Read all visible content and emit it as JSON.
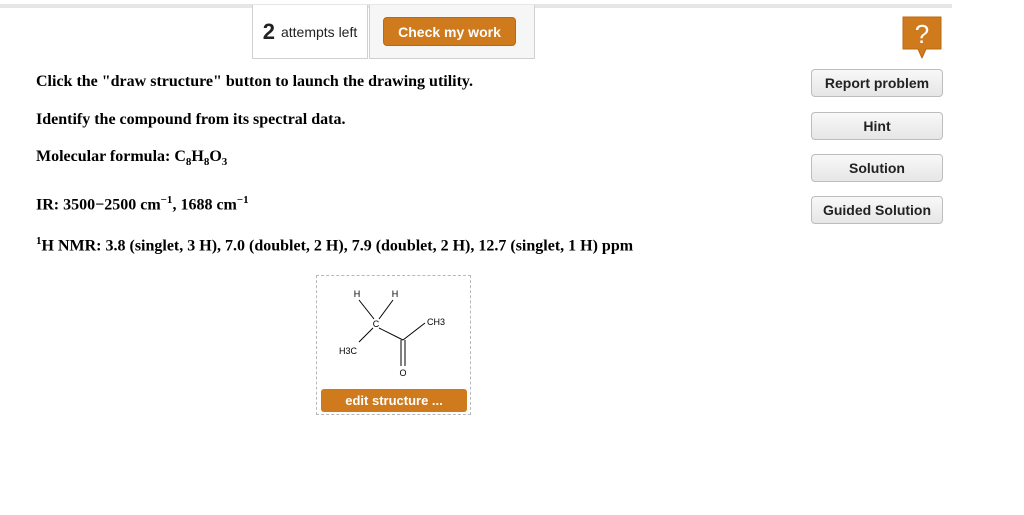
{
  "toolbar": {
    "attempts_count": "2",
    "attempts_label": "attempts left",
    "check_label": "Check my work",
    "help_glyph": "?"
  },
  "side_buttons": {
    "report": "Report problem",
    "hint": "Hint",
    "solution": "Solution",
    "guided": "Guided Solution"
  },
  "question": {
    "instruction": "Click the \"draw structure\" button to launch the drawing utility.",
    "task": "Identify the compound from its spectral data.",
    "formula_label": "Molecular formula: C",
    "formula_c_count": "8",
    "formula_h": "H",
    "formula_h_count": "8",
    "formula_o": "O",
    "formula_o_count": "3",
    "ir_prefix": "IR: 3500−2500 cm",
    "ir_exp1": "−1",
    "ir_mid": ", 1688 cm",
    "ir_exp2": "−1",
    "nmr_sup": "1",
    "nmr_text": "H NMR: 3.8 (singlet, 3 H), 7.0 (doublet, 2 H), 7.9 (doublet, 2 H), 12.7 (singlet, 1 H) ppm"
  },
  "structure": {
    "atom_h1": "H",
    "atom_h2": "H",
    "atom_c": "C",
    "atom_ch3": "CH3",
    "atom_h3c": "H3C",
    "atom_o": "O",
    "edit_label": "edit structure ..."
  },
  "colors": {
    "accent": "#cf7a1c",
    "button_bg": "#ececec"
  },
  "icons": [
    "help-icon"
  ]
}
